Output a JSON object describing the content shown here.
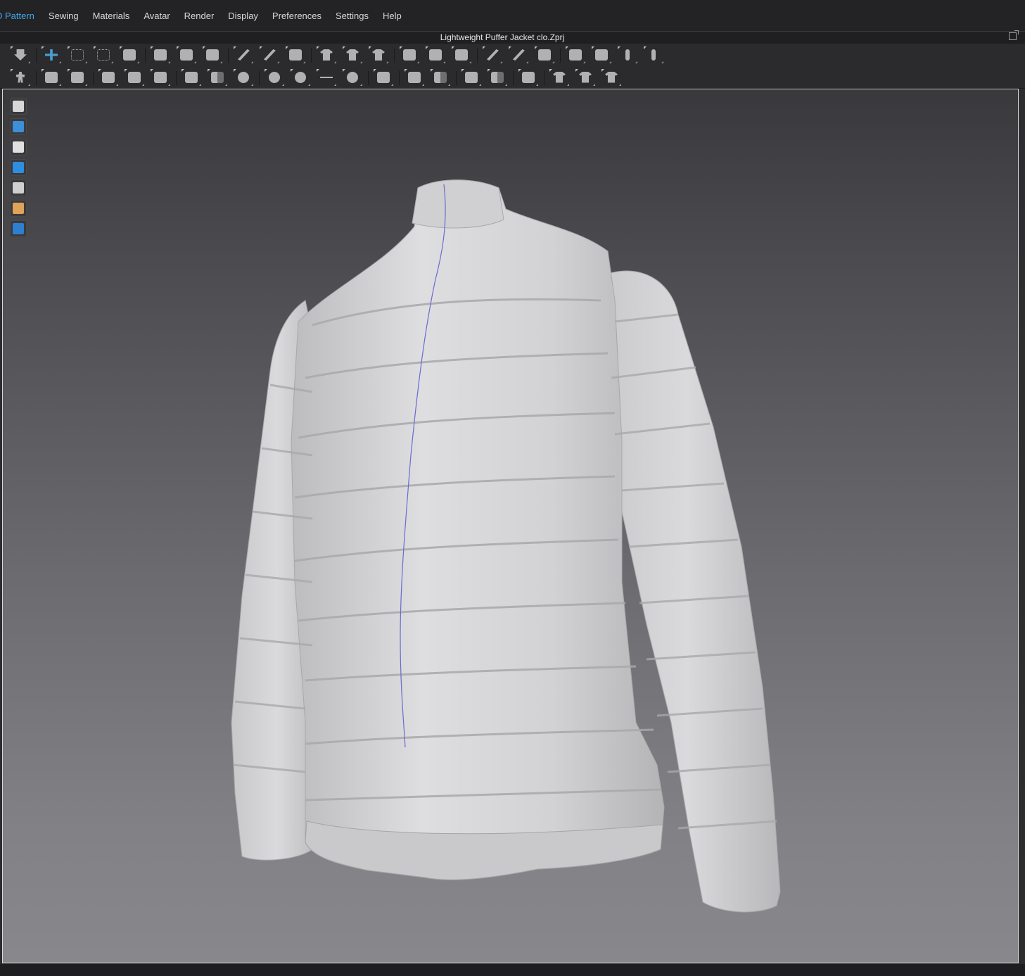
{
  "menu": {
    "items": [
      {
        "label": "D Pattern",
        "active": true
      },
      {
        "label": "Sewing"
      },
      {
        "label": "Materials"
      },
      {
        "label": "Avatar"
      },
      {
        "label": "Render"
      },
      {
        "label": "Display"
      },
      {
        "label": "Preferences"
      },
      {
        "label": "Settings"
      },
      {
        "label": "Help"
      }
    ]
  },
  "window": {
    "title": "Lightweight Puffer Jacket clo.Zprj"
  },
  "toolbar1": {
    "tools": [
      "simulation-icon",
      "select-move-icon",
      "box-select-icon",
      "transform-icon",
      "fold-icon",
      "undo-arrange-icon",
      "arrangement-icon",
      "reset-icon",
      "tack-icon",
      "pin-icon",
      "strengthen-icon",
      "symmetry-icon",
      "garment-fit-icon",
      "avatar-arrange-icon",
      "layer-up-icon",
      "layer-down-icon",
      "layer-clone-icon",
      "stack-icon",
      "stack-2-icon",
      "zipper-icon",
      "zipper-2-icon",
      "measure-icon",
      "tape-icon",
      "ruler-icon"
    ],
    "accent_color": "#4cb3f0"
  },
  "toolbar2": {
    "tools": [
      "avatar-pose-icon",
      "edit-texture-icon",
      "edit-graphic-icon",
      "puckering-icon",
      "trim-icon",
      "piece-icon",
      "topstitch-icon",
      "pattern-fill-icon",
      "quilt-icon",
      "button-icon",
      "buttonhole-icon",
      "line-icon",
      "lock-button-icon",
      "zipper-slider-icon",
      "fold-arrange-icon",
      "fabric-fill-icon",
      "shrink-icon",
      "fabric-shade-icon",
      "merge-icon",
      "shirt-pin-icon",
      "shirt-icon",
      "collar-icon"
    ]
  },
  "viewport": {
    "side_tools": [
      {
        "icon": "garment-display-icon",
        "color": "#d8d8d8"
      },
      {
        "icon": "avatar-display-icon",
        "color": "#3c8fd8"
      },
      {
        "icon": "avatar-silhouette-icon",
        "color": "#e0e0e0"
      },
      {
        "icon": "fabric-render-icon",
        "color": "#2f8ee0"
      },
      {
        "icon": "texture-icon",
        "color": "#cfcfcf"
      },
      {
        "icon": "avatar-skin-icon",
        "color": "#e0a35a"
      },
      {
        "icon": "environment-icon",
        "color": "#2e7fd0"
      }
    ],
    "background_top": "#39393c",
    "background_bottom": "#88888c",
    "garment_color": "#d6d6d8",
    "seam_color": "#6a6ad0"
  }
}
